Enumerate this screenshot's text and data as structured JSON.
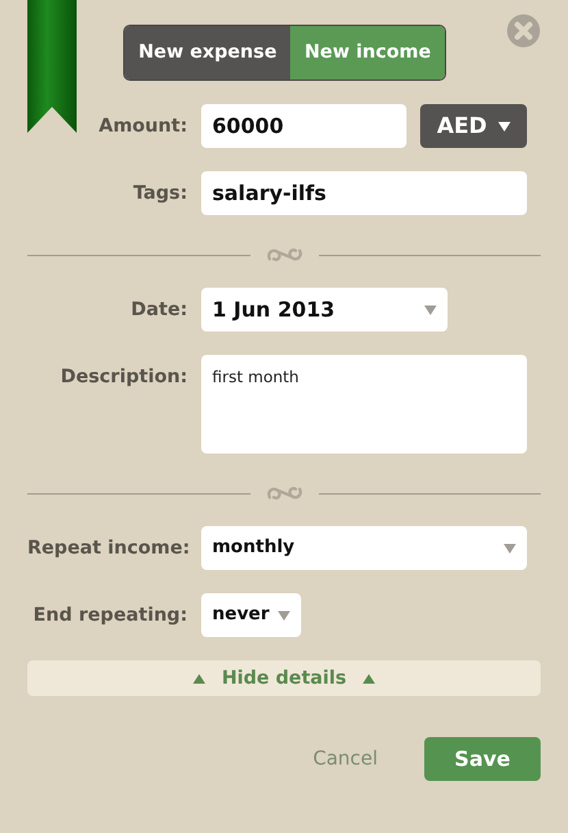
{
  "toggle": [
    {
      "label": "New expense",
      "selected": false
    },
    {
      "label": "New income",
      "selected": true
    }
  ],
  "form": [
    {
      "kind": "amount",
      "label": "Amount:",
      "value": "60000",
      "currency": "AED"
    },
    {
      "kind": "text",
      "label": "Tags:",
      "value": "salary-ilfs"
    },
    {
      "kind": "divider"
    },
    {
      "kind": "date",
      "label": "Date:",
      "value": "1 Jun 2013"
    },
    {
      "kind": "textarea",
      "label": "Description:",
      "value": "first month"
    },
    {
      "kind": "divider"
    },
    {
      "kind": "select",
      "label": "Repeat income:",
      "value": "monthly"
    },
    {
      "kind": "compact-select",
      "label": "End repeating:",
      "value": "never"
    }
  ],
  "details_toggle": {
    "label": "Hide details",
    "expanded": true
  },
  "actions": {
    "cancel": "Cancel",
    "save": "Save"
  }
}
